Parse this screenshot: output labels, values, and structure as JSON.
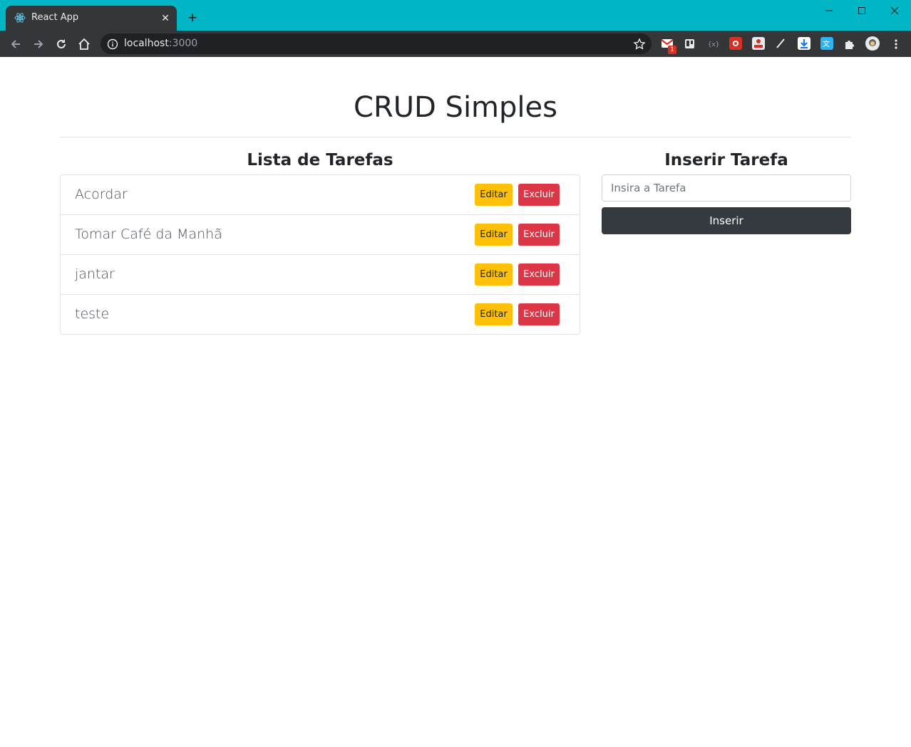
{
  "browser": {
    "tab_title": "React App",
    "tab_close_glyph": "✕",
    "new_tab_glyph": "+",
    "url_host": "localhost",
    "url_port": ":3000",
    "colors": {
      "titlebar": "#00b5c4",
      "toolbar": "#35363a",
      "omnibox": "#202124"
    },
    "extensions": [
      "gmail-icon",
      "trello-icon",
      "code-icon",
      "puzzle-red-icon",
      "gdm-icon",
      "pen-icon",
      "download-icon",
      "translate-icon",
      "extensions-icon",
      "profile-avatar"
    ],
    "gmail_badge": "1"
  },
  "page": {
    "title": "CRUD Simples"
  },
  "list_section": {
    "title": "Lista de Tarefas",
    "edit_label": "Editar",
    "delete_label": "Excluir",
    "items": [
      {
        "text": "Acordar"
      },
      {
        "text": "Tomar Café da Manhã"
      },
      {
        "text": "jantar"
      },
      {
        "text": "teste"
      }
    ]
  },
  "form_section": {
    "title": "Inserir Tarefa",
    "input_placeholder": "Insira a Tarefa",
    "input_value": "",
    "submit_label": "Inserir"
  }
}
